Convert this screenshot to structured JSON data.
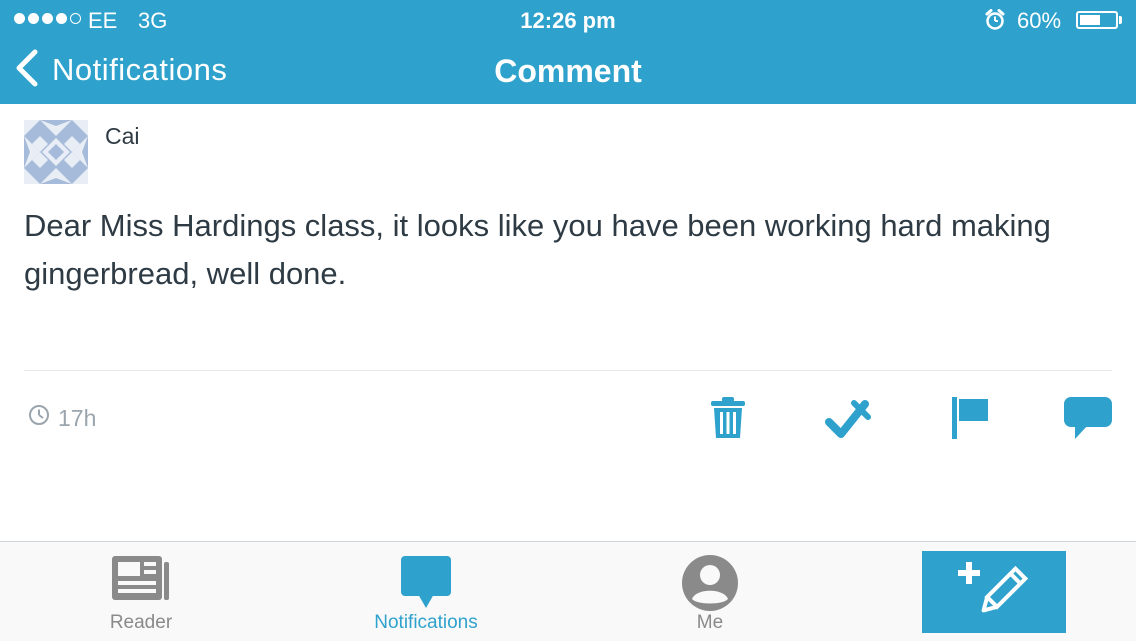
{
  "status_bar": {
    "carrier": "EE",
    "network": "3G",
    "time": "12:26 pm",
    "battery_percent_label": "60%",
    "battery_level": 0.6,
    "signal_bars_filled": 4,
    "signal_bars_total": 5,
    "alarm_icon": "alarm-clock-icon"
  },
  "nav": {
    "back_label": "Notifications",
    "title": "Comment"
  },
  "comment": {
    "author": "Cai",
    "avatar_icon": "identicon-avatar",
    "text": "Dear Miss Hardings class, it looks like you have been working hard making gingerbread, well done.",
    "timestamp": "17h"
  },
  "actions": [
    {
      "name": "trash-icon",
      "label": "Trash"
    },
    {
      "name": "approve-icon",
      "label": "Approve"
    },
    {
      "name": "flag-icon",
      "label": "Spam"
    },
    {
      "name": "reply-icon",
      "label": "Reply"
    }
  ],
  "tabbar": {
    "reader": "Reader",
    "notifications": "Notifications",
    "me": "Me",
    "compose_icon": "new-post-icon"
  },
  "colors": {
    "accent": "#2ea2cc",
    "text": "#2e3b44",
    "muted": "#9aa5ad",
    "tab_inactive": "#8a8a8a"
  }
}
